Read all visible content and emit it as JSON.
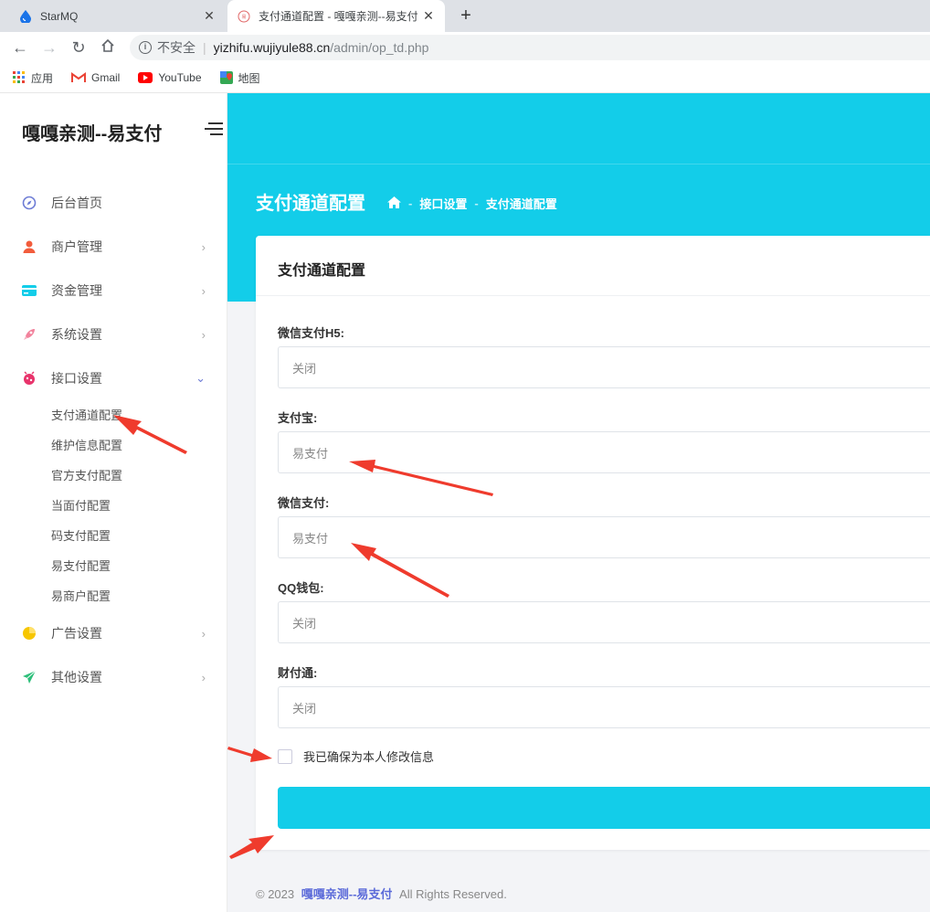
{
  "browser": {
    "tabs": [
      {
        "title": "StarMQ",
        "active": false
      },
      {
        "title": "支付通道配置 - 嘎嘎亲测--易支付",
        "active": true
      }
    ],
    "new_tab": "+",
    "close_glyph": "✕",
    "security_label": "不安全",
    "url_host": "yizhifu.wujiyule88.cn",
    "url_path": "/admin/op_td.php",
    "bookmarks": [
      "应用",
      "Gmail",
      "YouTube",
      "地图"
    ]
  },
  "sidebar": {
    "brand": "嘎嘎亲测--易支付",
    "menu": [
      {
        "label": "后台首页",
        "icon": "compass-icon",
        "color": "#6d7cd5"
      },
      {
        "label": "商户管理",
        "icon": "user-icon",
        "color": "#f25c3c"
      },
      {
        "label": "资金管理",
        "icon": "card-icon",
        "color": "#13cde9"
      },
      {
        "label": "系统设置",
        "icon": "rocket-icon",
        "color": "#f2829c"
      },
      {
        "label": "接口设置",
        "icon": "bug-icon",
        "color": "#e8336b"
      },
      {
        "label": "广告设置",
        "icon": "pie-chart-icon",
        "color": "#f7c600"
      },
      {
        "label": "其他设置",
        "icon": "send-icon",
        "color": "#2dbf7a"
      }
    ],
    "submenu": [
      "支付通道配置",
      "维护信息配置",
      "官方支付配置",
      "当面付配置",
      "码支付配置",
      "易支付配置",
      "易商户配置"
    ]
  },
  "header": {
    "page_title": "支付通道配置",
    "breadcrumb": [
      "接口设置",
      "支付通道配置"
    ],
    "breadcrumb_sep": "-"
  },
  "card": {
    "title": "支付通道配置",
    "fields": [
      {
        "label": "微信支付H5:",
        "value": "关闭"
      },
      {
        "label": "支付宝:",
        "value": "易支付"
      },
      {
        "label": "微信支付:",
        "value": "易支付"
      },
      {
        "label": "QQ钱包:",
        "value": "关闭"
      },
      {
        "label": "财付通:",
        "value": "关闭"
      }
    ],
    "confirm_label": "我已确保为本人修改信息"
  },
  "footer": {
    "prefix": "© 2023",
    "link": "嘎嘎亲测--易支付",
    "suffix": "All Rights Reserved."
  },
  "colors": {
    "accent": "#13cde9",
    "arrow": "#ef3b2d",
    "link": "#5b6ad9"
  }
}
